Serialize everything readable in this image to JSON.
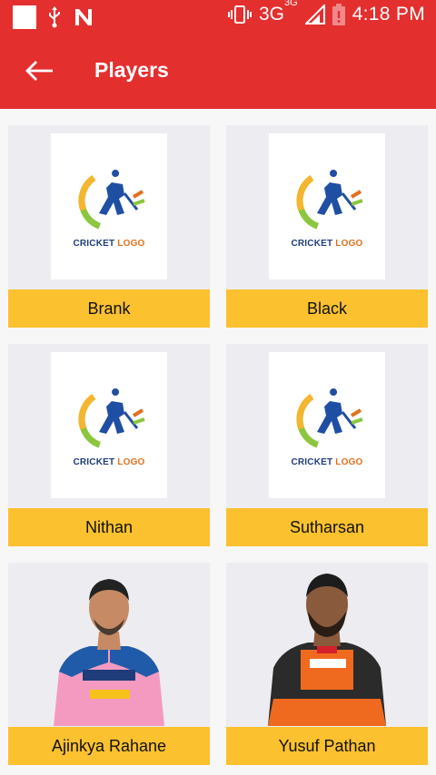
{
  "status_bar": {
    "network": "3G",
    "network_sup": "3G",
    "time": "4:18 PM"
  },
  "app_bar": {
    "title": "Players"
  },
  "players": [
    {
      "name": "Brank",
      "image": "cricket-logo"
    },
    {
      "name": "Black",
      "image": "cricket-logo"
    },
    {
      "name": "Nithan",
      "image": "cricket-logo"
    },
    {
      "name": "Sutharsan",
      "image": "cricket-logo"
    },
    {
      "name": "Ajinkya Rahane",
      "image": "player-photo"
    },
    {
      "name": "Yusuf Pathan",
      "image": "player-photo"
    }
  ],
  "logo": {
    "word1": "CRICKET",
    "word2": "LOGO"
  },
  "colors": {
    "app_bar": "#e42f2f",
    "label_bg": "#fbc12f",
    "card_bg": "#ededf1"
  }
}
